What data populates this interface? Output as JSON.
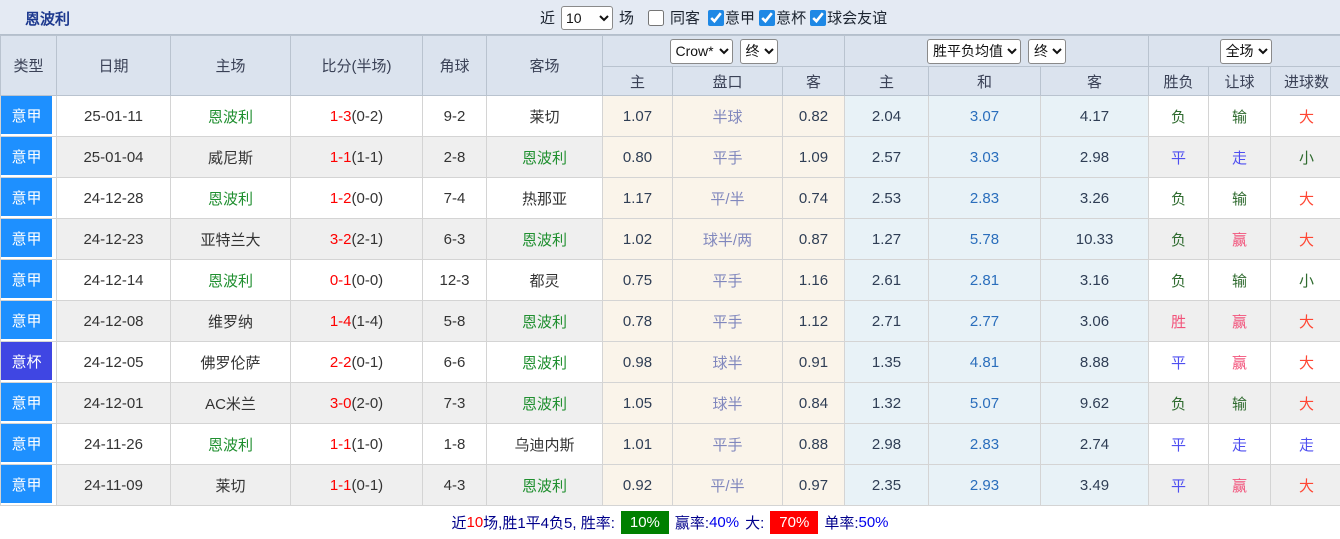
{
  "page": {
    "title": "恩波利"
  },
  "colors": {
    "seriea_badge": "#1e90ff",
    "cup_badge": "#3f46e3",
    "focus_team_green": "#1f8f2f",
    "score_red": "#ff0000",
    "handicap_bg": "#faf4ea",
    "handicap_line_text": "#8087bd",
    "europe_bg": "#e8f2f7",
    "draw_odds_blue": "#2a6ebc",
    "win_red": "#f2527a",
    "push_blue": "#4f4ff0",
    "lose_green": "#2f6b2f",
    "big_red": "#ff4633",
    "badge_green_bg": "#008000",
    "badge_red_bg": "#ff0000",
    "footer_navy": "#00008b"
  },
  "topbar": {
    "near_label": "近",
    "near_value": "10",
    "games_label": "场",
    "same_away": {
      "label": "同客",
      "checked": false
    },
    "filters": [
      {
        "label": "意甲",
        "checked": true
      },
      {
        "label": "意杯",
        "checked": true
      },
      {
        "label": "球会友谊",
        "checked": true
      }
    ]
  },
  "table": {
    "columns": {
      "type": "类型",
      "date": "日期",
      "home": "主场",
      "score": "比分(半场)",
      "corners": "角球",
      "away": "客场",
      "ah_home": "主",
      "ah_line": "盘口",
      "ah_away": "客",
      "eu_home": "主",
      "eu_draw": "和",
      "eu_away": "客",
      "result": "胜负",
      "handicap_result": "让球",
      "goals_result": "进球数"
    },
    "selects": {
      "handicap_company": "Crow*",
      "handicap_time": "终",
      "odds_type": "胜平负均值",
      "odds_time": "终",
      "scope": "全场"
    },
    "rows": [
      {
        "type": "意甲",
        "type_variant": "seriea",
        "date": "25-01-11",
        "home": "恩波利",
        "home_focus": true,
        "score_full": "1-3",
        "score_half": "(0-2)",
        "corners": "9-2",
        "away": "莱切",
        "away_focus": false,
        "ah_home": "1.07",
        "ah_line": "半球",
        "ah_away": "0.82",
        "eu_home": "2.04",
        "eu_draw": "3.07",
        "eu_away": "4.17",
        "result": {
          "text": "负",
          "variant": "lose"
        },
        "handicap_result": {
          "text": "输",
          "variant": "lose"
        },
        "goals_result": {
          "text": "大",
          "variant": "big"
        }
      },
      {
        "type": "意甲",
        "type_variant": "seriea",
        "date": "25-01-04",
        "home": "威尼斯",
        "home_focus": false,
        "score_full": "1-1",
        "score_half": "(1-1)",
        "corners": "2-8",
        "away": "恩波利",
        "away_focus": true,
        "ah_home": "0.80",
        "ah_line": "平手",
        "ah_away": "1.09",
        "eu_home": "2.57",
        "eu_draw": "3.03",
        "eu_away": "2.98",
        "result": {
          "text": "平",
          "variant": "draw"
        },
        "handicap_result": {
          "text": "走",
          "variant": "push"
        },
        "goals_result": {
          "text": "小",
          "variant": "small"
        }
      },
      {
        "type": "意甲",
        "type_variant": "seriea",
        "date": "24-12-28",
        "home": "恩波利",
        "home_focus": true,
        "score_full": "1-2",
        "score_half": "(0-0)",
        "corners": "7-4",
        "away": "热那亚",
        "away_focus": false,
        "ah_home": "1.17",
        "ah_line": "平/半",
        "ah_away": "0.74",
        "eu_home": "2.53",
        "eu_draw": "2.83",
        "eu_away": "3.26",
        "result": {
          "text": "负",
          "variant": "lose"
        },
        "handicap_result": {
          "text": "输",
          "variant": "lose"
        },
        "goals_result": {
          "text": "大",
          "variant": "big"
        }
      },
      {
        "type": "意甲",
        "type_variant": "seriea",
        "date": "24-12-23",
        "home": "亚特兰大",
        "home_focus": false,
        "score_full": "3-2",
        "score_half": "(2-1)",
        "corners": "6-3",
        "away": "恩波利",
        "away_focus": true,
        "ah_home": "1.02",
        "ah_line": "球半/两",
        "ah_away": "0.87",
        "eu_home": "1.27",
        "eu_draw": "5.78",
        "eu_away": "10.33",
        "result": {
          "text": "负",
          "variant": "lose"
        },
        "handicap_result": {
          "text": "赢",
          "variant": "win"
        },
        "goals_result": {
          "text": "大",
          "variant": "big"
        }
      },
      {
        "type": "意甲",
        "type_variant": "seriea",
        "date": "24-12-14",
        "home": "恩波利",
        "home_focus": true,
        "score_full": "0-1",
        "score_half": "(0-0)",
        "corners": "12-3",
        "away": "都灵",
        "away_focus": false,
        "ah_home": "0.75",
        "ah_line": "平手",
        "ah_away": "1.16",
        "eu_home": "2.61",
        "eu_draw": "2.81",
        "eu_away": "3.16",
        "result": {
          "text": "负",
          "variant": "lose"
        },
        "handicap_result": {
          "text": "输",
          "variant": "lose"
        },
        "goals_result": {
          "text": "小",
          "variant": "small"
        }
      },
      {
        "type": "意甲",
        "type_variant": "seriea",
        "date": "24-12-08",
        "home": "维罗纳",
        "home_focus": false,
        "score_full": "1-4",
        "score_half": "(1-4)",
        "corners": "5-8",
        "away": "恩波利",
        "away_focus": true,
        "ah_home": "0.78",
        "ah_line": "平手",
        "ah_away": "1.12",
        "eu_home": "2.71",
        "eu_draw": "2.77",
        "eu_away": "3.06",
        "result": {
          "text": "胜",
          "variant": "win"
        },
        "handicap_result": {
          "text": "赢",
          "variant": "win"
        },
        "goals_result": {
          "text": "大",
          "variant": "big"
        }
      },
      {
        "type": "意杯",
        "type_variant": "cup",
        "date": "24-12-05",
        "home": "佛罗伦萨",
        "home_focus": false,
        "score_full": "2-2",
        "score_half": "(0-1)",
        "corners": "6-6",
        "away": "恩波利",
        "away_focus": true,
        "ah_home": "0.98",
        "ah_line": "球半",
        "ah_away": "0.91",
        "eu_home": "1.35",
        "eu_draw": "4.81",
        "eu_away": "8.88",
        "result": {
          "text": "平",
          "variant": "draw"
        },
        "handicap_result": {
          "text": "赢",
          "variant": "win"
        },
        "goals_result": {
          "text": "大",
          "variant": "big"
        }
      },
      {
        "type": "意甲",
        "type_variant": "seriea",
        "date": "24-12-01",
        "home": "AC米兰",
        "home_focus": false,
        "score_full": "3-0",
        "score_half": "(2-0)",
        "corners": "7-3",
        "away": "恩波利",
        "away_focus": true,
        "ah_home": "1.05",
        "ah_line": "球半",
        "ah_away": "0.84",
        "eu_home": "1.32",
        "eu_draw": "5.07",
        "eu_away": "9.62",
        "result": {
          "text": "负",
          "variant": "lose"
        },
        "handicap_result": {
          "text": "输",
          "variant": "lose"
        },
        "goals_result": {
          "text": "大",
          "variant": "big"
        }
      },
      {
        "type": "意甲",
        "type_variant": "seriea",
        "date": "24-11-26",
        "home": "恩波利",
        "home_focus": true,
        "score_full": "1-1",
        "score_half": "(1-0)",
        "corners": "1-8",
        "away": "乌迪内斯",
        "away_focus": false,
        "ah_home": "1.01",
        "ah_line": "平手",
        "ah_away": "0.88",
        "eu_home": "2.98",
        "eu_draw": "2.83",
        "eu_away": "2.74",
        "result": {
          "text": "平",
          "variant": "draw"
        },
        "handicap_result": {
          "text": "走",
          "variant": "push"
        },
        "goals_result": {
          "text": "走",
          "variant": "push"
        }
      },
      {
        "type": "意甲",
        "type_variant": "seriea",
        "date": "24-11-09",
        "home": "莱切",
        "home_focus": false,
        "score_full": "1-1",
        "score_half": "(0-1)",
        "corners": "4-3",
        "away": "恩波利",
        "away_focus": true,
        "ah_home": "0.92",
        "ah_line": "平/半",
        "ah_away": "0.97",
        "eu_home": "2.35",
        "eu_draw": "2.93",
        "eu_away": "3.49",
        "result": {
          "text": "平",
          "variant": "draw"
        },
        "handicap_result": {
          "text": "赢",
          "variant": "win"
        },
        "goals_result": {
          "text": "大",
          "variant": "big"
        }
      }
    ]
  },
  "footer": {
    "near_label": "近",
    "near_count": "10",
    "summary_rest": "场,胜1平4负5, 胜率:",
    "win_rate": "10%",
    "label_win_odds": "赢率:",
    "win_odds_rate": "40%",
    "label_big": "大:",
    "big_rate": "70%",
    "label_single": "单率:",
    "single_rate": "50%"
  }
}
